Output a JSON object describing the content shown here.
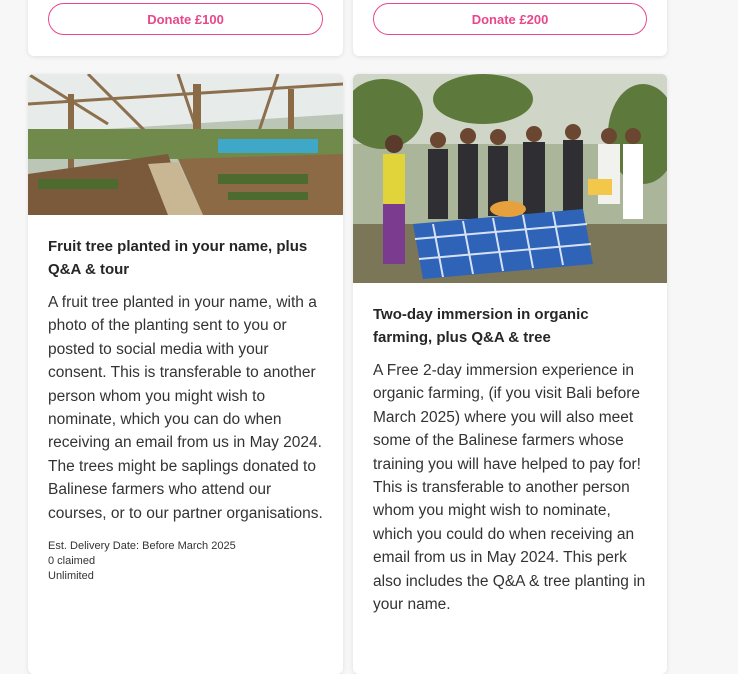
{
  "donations": [
    {
      "label": "Donate £100"
    },
    {
      "label": "Donate £200"
    }
  ],
  "perks": [
    {
      "title": "Fruit tree planted in your name, plus Q&A & tour",
      "description": "A fruit tree planted in your name, with a photo of the planting sent to you or posted to social media with your consent. This is transferable to another person whom you might wish to nominate, which you can do when receiving an email from us in May 2024. The trees might be saplings donated to Balinese farmers who attend our courses, or to our partner organisations.",
      "delivery": "Est. Delivery Date: Before March 2025",
      "claimed": "0 claimed",
      "availability": "Unlimited"
    },
    {
      "title": "Two-day immersion in organic farming, plus Q&A & tree",
      "description": "A Free 2-day immersion experience in organic farming, (if you visit Bali before March 2025) where you will also meet some of the Balinese farmers whose training you will have helped to pay for! This is transferable to another person whom you might wish to nominate, which you could do when receiving an email from us in May 2024. This perk also includes the Q&A & tree planting in your name."
    }
  ],
  "colors": {
    "accent": "#e8478b"
  }
}
